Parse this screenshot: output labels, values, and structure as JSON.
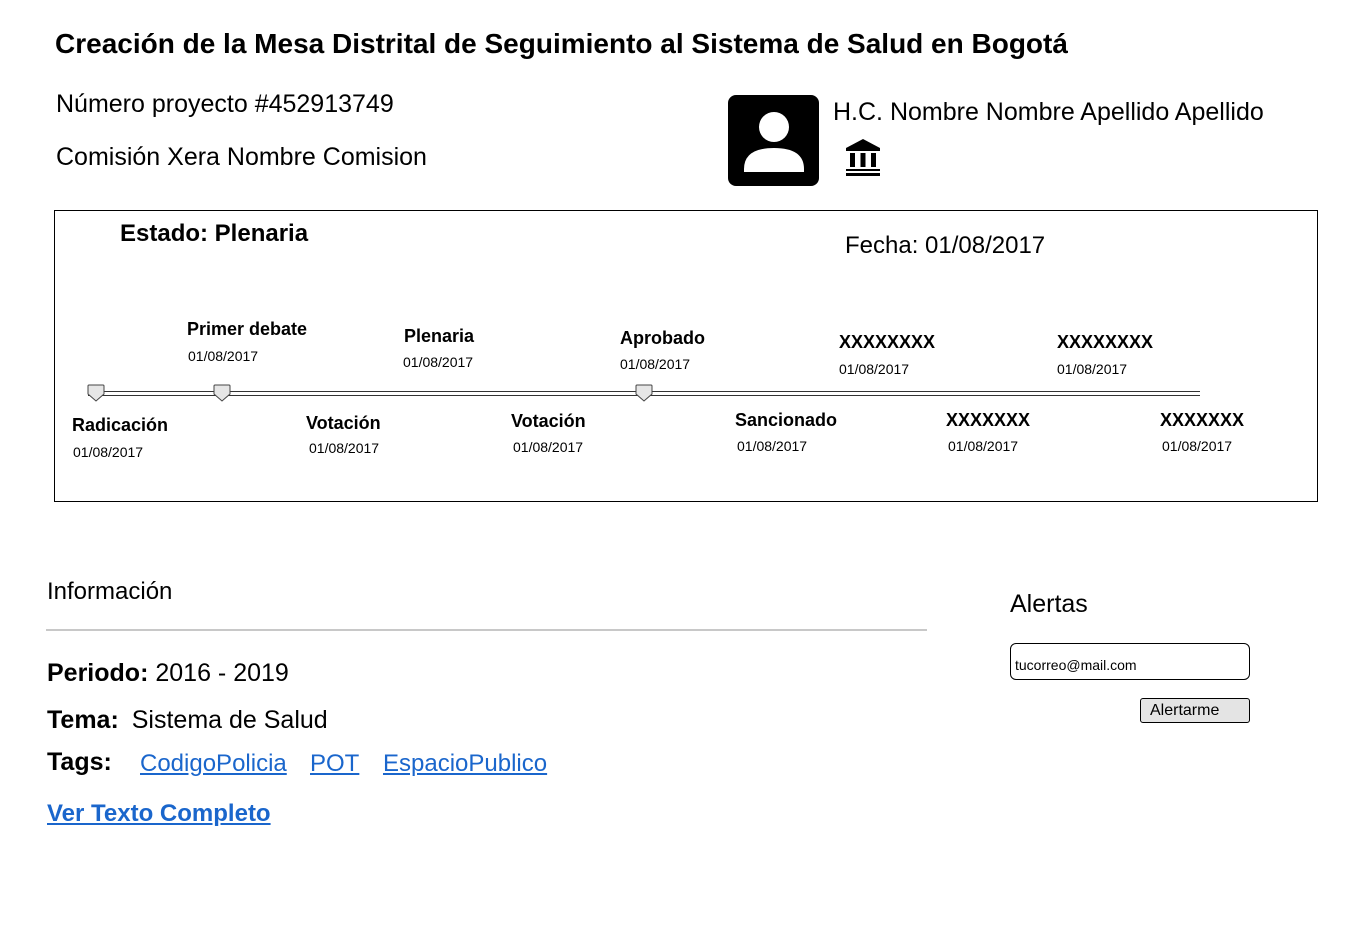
{
  "project": {
    "title": "Creación de la Mesa Distrital de Seguimiento al Sistema de Salud en Bogotá",
    "number_label": "Número proyecto #452913749",
    "commission_label": "Comisión Xera  Nombre Comision"
  },
  "legislator": {
    "name": "H.C. Nombre Nombre Apellido Apellido",
    "avatar_icon": "person-icon",
    "institution_icon": "bank-icon"
  },
  "status": {
    "estado": "Estado: Plenaria",
    "fecha": "Fecha: 01/08/2017"
  },
  "timeline": {
    "top_stages": [
      {
        "label": "Primer debate",
        "date": "01/08/2017"
      },
      {
        "label": "Plenaria",
        "date": "01/08/2017"
      },
      {
        "label": "Aprobado",
        "date": "01/08/2017"
      },
      {
        "label": "XXXXXXXX",
        "date": "01/08/2017"
      },
      {
        "label": "XXXXXXXX",
        "date": "01/08/2017"
      }
    ],
    "bottom_stages": [
      {
        "label": "Radicación",
        "date": "01/08/2017"
      },
      {
        "label": "Votación",
        "date": "01/08/2017"
      },
      {
        "label": "Votación",
        "date": "01/08/2017"
      },
      {
        "label": "Sancionado",
        "date": "01/08/2017"
      },
      {
        "label": "XXXXXXX",
        "date": "01/08/2017"
      },
      {
        "label": "XXXXXXX",
        "date": "01/08/2017"
      }
    ]
  },
  "info": {
    "heading": "Información",
    "periodo_label": "Periodo:",
    "periodo_value": "2016 - 2019",
    "tema_label": "Tema:",
    "tema_value": "Sistema de Salud",
    "tags_label": "Tags:",
    "tags": [
      "CodigoPolicia",
      "POT",
      "EspacioPublico"
    ],
    "full_text_link": "Ver Texto Completo"
  },
  "alerts": {
    "heading": "Alertas",
    "email_placeholder": "tucorreo@mail.com",
    "button_label": "Alertarme"
  },
  "colors": {
    "link": "#1a66cc",
    "button_bg": "#e4e4e4",
    "rule": "#c8c8c8"
  }
}
